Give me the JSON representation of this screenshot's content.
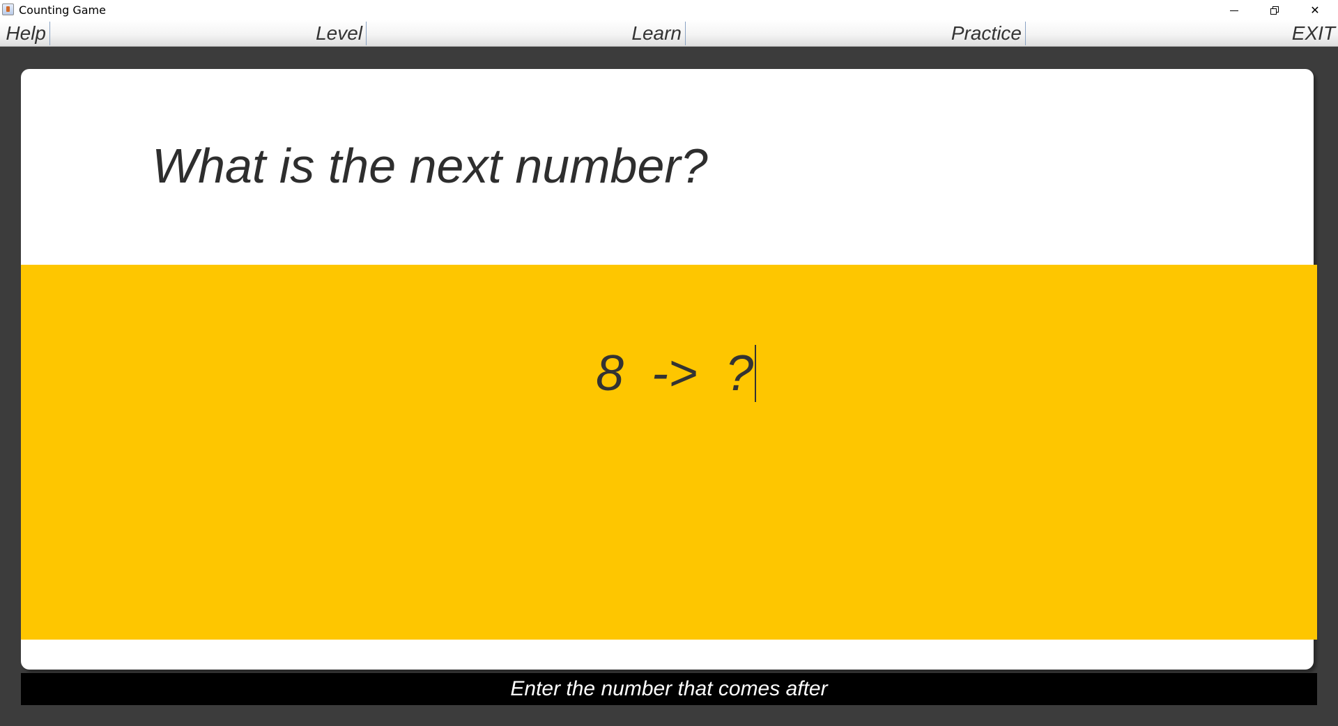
{
  "window": {
    "title": "Counting Game",
    "icon": "java-app-icon",
    "controls": {
      "minimize_icon": "minimize-icon",
      "restore_icon": "restore-icon",
      "close_label": "✕"
    }
  },
  "menu": {
    "items": [
      {
        "label": "Help"
      },
      {
        "label": "Level"
      },
      {
        "label": "Learn"
      },
      {
        "label": "Practice"
      },
      {
        "label": "EXIT"
      }
    ]
  },
  "main": {
    "question": "What is the next number?",
    "sequence": "8  ->  ?",
    "band_color": "#fec600"
  },
  "status": {
    "message": "Enter the number that comes after"
  }
}
